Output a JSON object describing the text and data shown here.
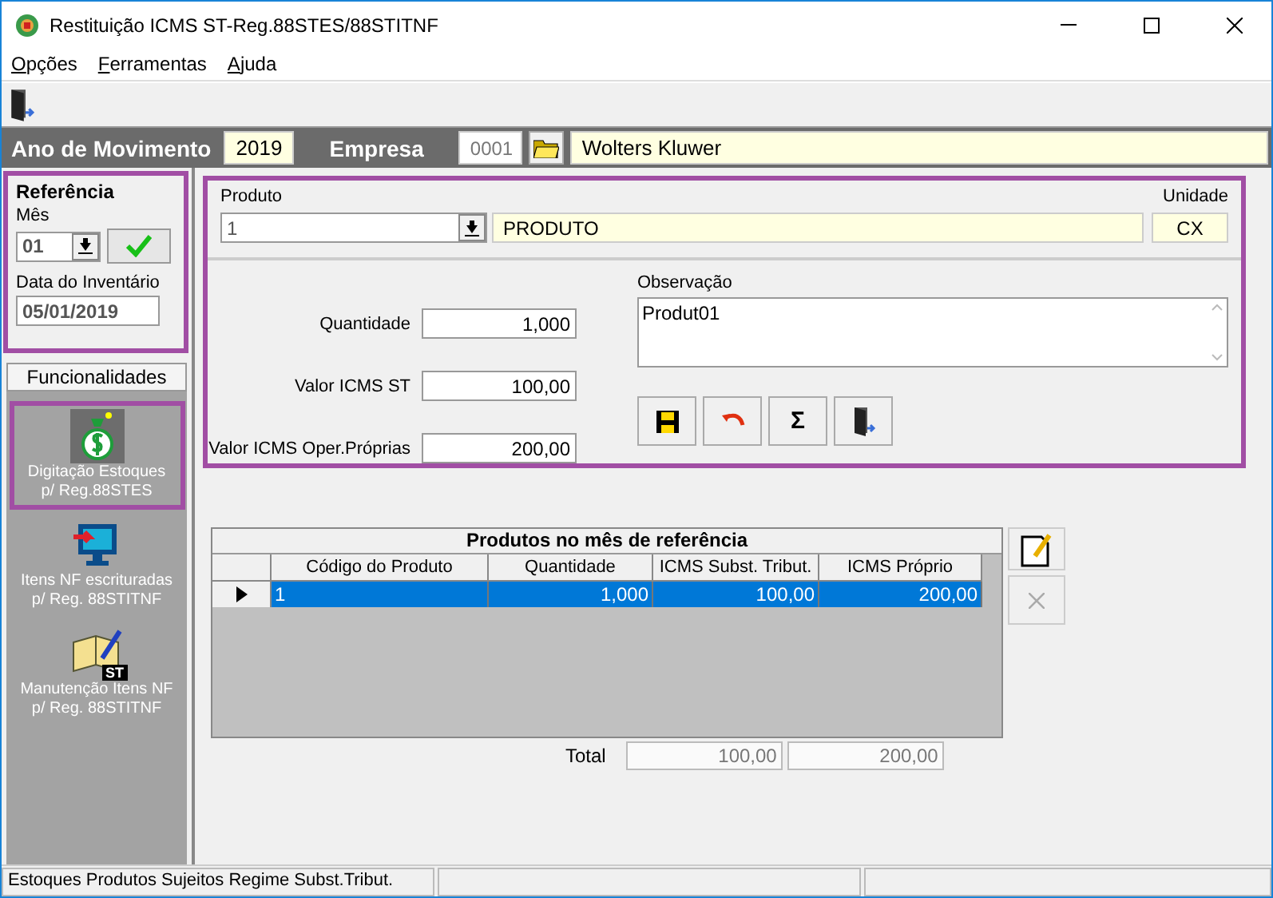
{
  "window": {
    "title": "Restituição ICMS ST-Reg.88STES/88STITNF"
  },
  "menu": [
    {
      "label": "Opções"
    },
    {
      "label": "Ferramentas"
    },
    {
      "label": "Ajuda"
    }
  ],
  "header": {
    "ano_label": "Ano de Movimento",
    "ano": "2019",
    "empresa_label": "Empresa",
    "empresa_code": "0001",
    "empresa_name": "Wolters Kluwer"
  },
  "referencia": {
    "title": "Referência",
    "mes_label": "Mês",
    "mes": "01",
    "data_label": "Data do Inventário",
    "data": "05/01/2019"
  },
  "sidebar": {
    "header": "Funcionalidades",
    "items": [
      {
        "kind": "money",
        "label": "Digitação Estoques\np/ Reg.88STES",
        "selected": true
      },
      {
        "kind": "monitor",
        "label": "Itens NF escrituradas\np/ Reg. 88STITNF",
        "selected": false
      },
      {
        "kind": "book",
        "badge": "ST",
        "label": "Manutenção Itens NF\np/ Reg. 88STITNF",
        "selected": false
      }
    ]
  },
  "form": {
    "produto_label": "Produto",
    "produto_code": "1",
    "produto_name": "PRODUTO",
    "unidade_label": "Unidade",
    "unidade": "CX",
    "fields": [
      {
        "label": "Quantidade",
        "value": "1,000"
      },
      {
        "label": "Valor ICMS ST",
        "value": "100,00"
      },
      {
        "label": "Valor ICMS Oper.Próprias",
        "value": "200,00"
      }
    ],
    "observacao_label": "Observação",
    "observacao": "Produt01",
    "buttons": [
      {
        "kind": "save"
      },
      {
        "kind": "undo"
      },
      {
        "kind": "sum",
        "label": "Σ"
      },
      {
        "kind": "exit"
      }
    ]
  },
  "grid": {
    "title": "Produtos no mês de referência",
    "columns": [
      "Código do Produto",
      "Quantidade",
      "ICMS Subst. Tribut.",
      "ICMS Próprio"
    ],
    "rows": [
      {
        "cells": [
          "1",
          "1,000",
          "100,00",
          "200,00"
        ],
        "selected": true
      }
    ],
    "side_buttons": [
      {
        "kind": "edit",
        "disabled": false
      },
      {
        "kind": "delete",
        "disabled": true
      }
    ],
    "total_label": "Total",
    "totals": [
      "100,00",
      "200,00"
    ]
  },
  "status_bar": {
    "text": "Estoques Produtos Sujeitos Regime Subst.Tribut."
  }
}
